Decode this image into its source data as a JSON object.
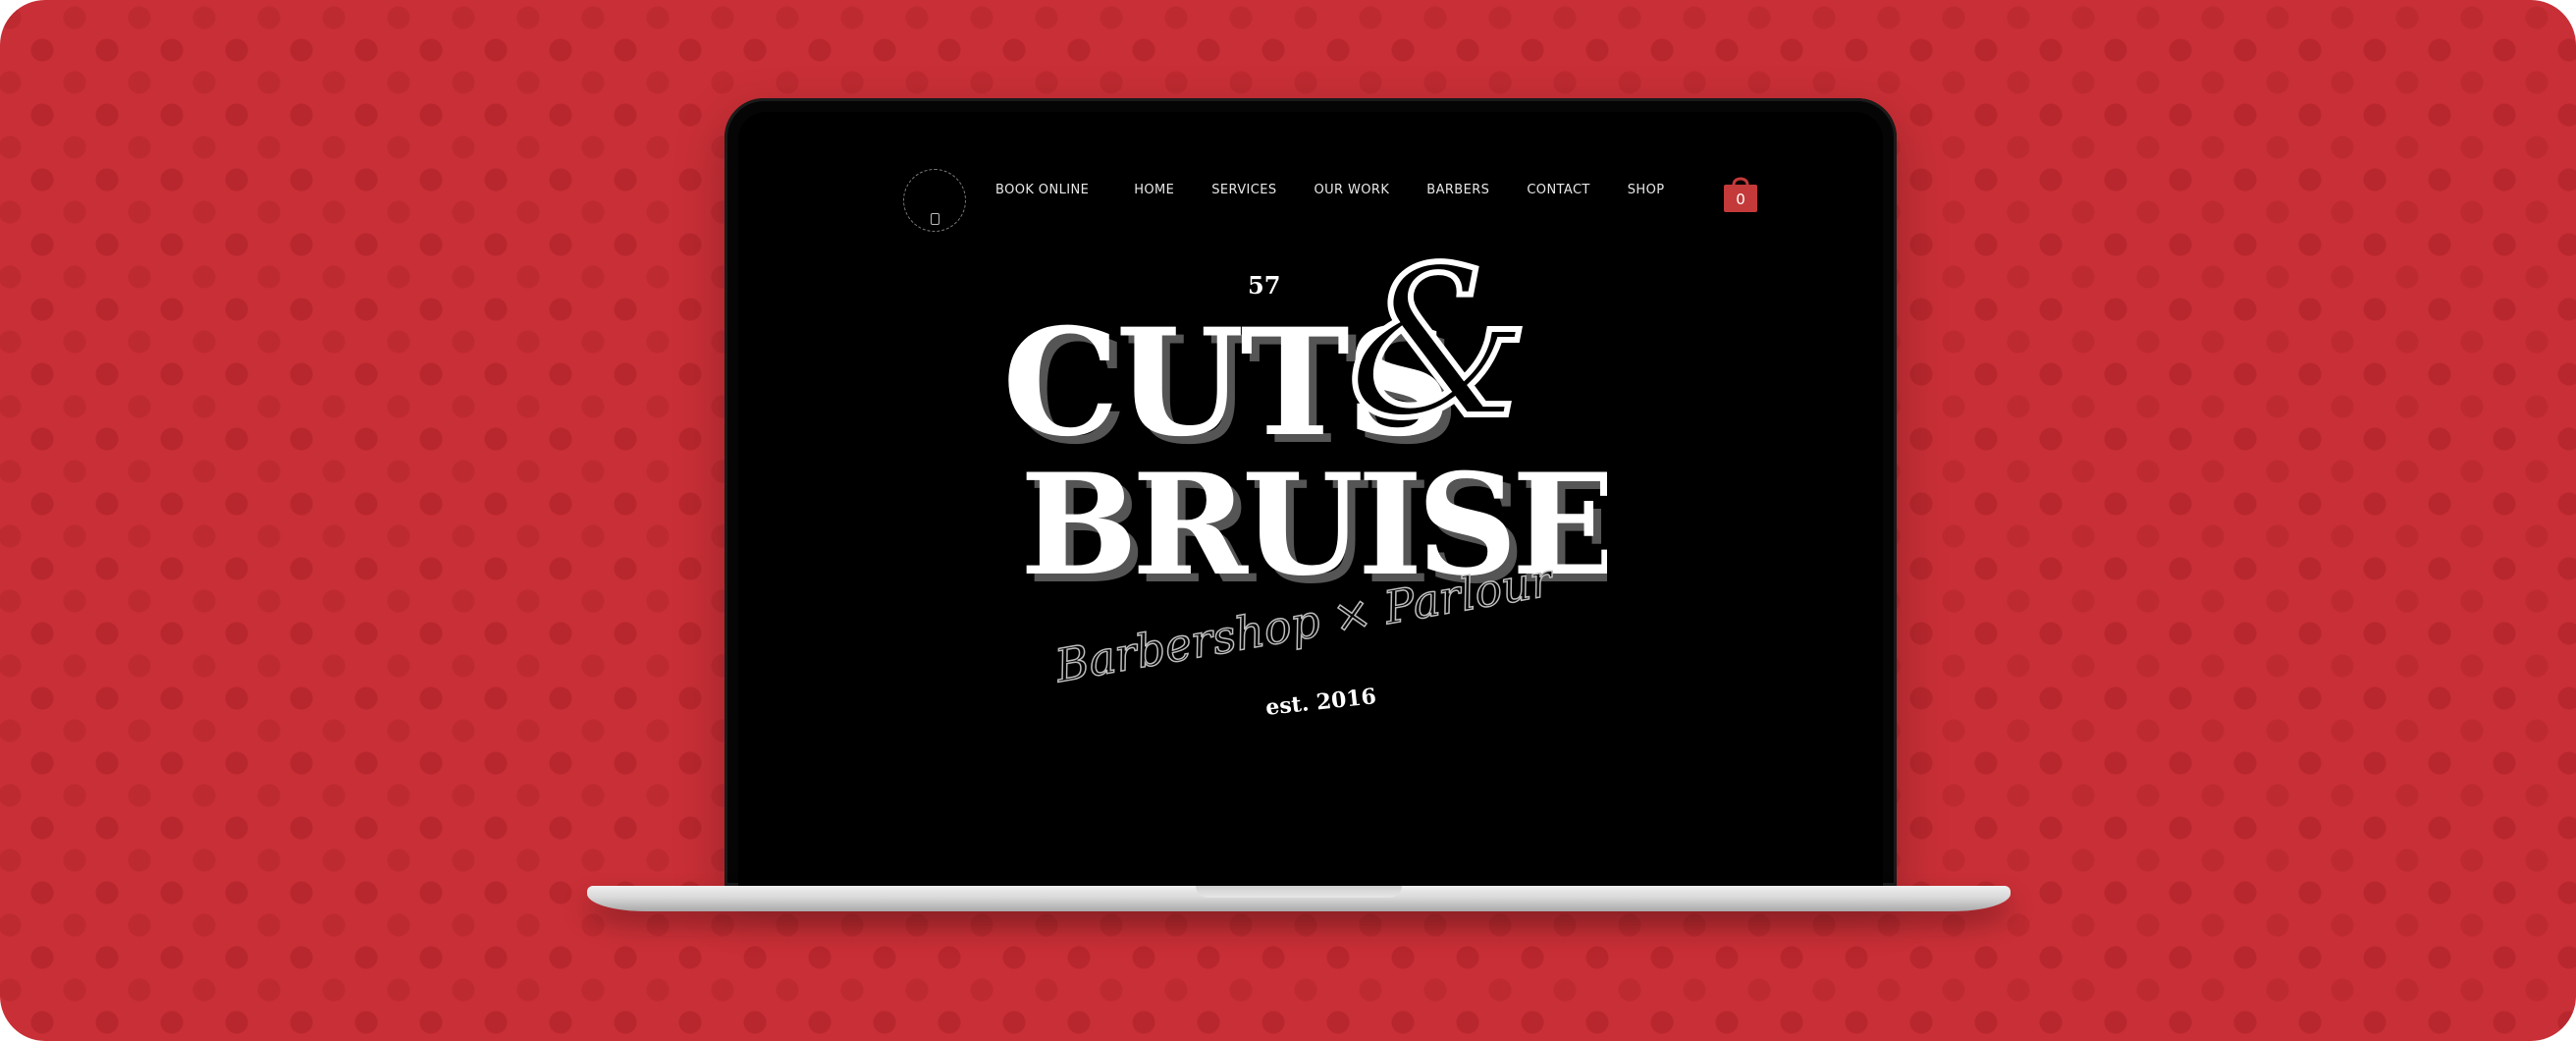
{
  "nav": {
    "logo_alt": "Cuts & Bruises Barbershop round logo",
    "items": [
      {
        "label": "BOOK ONLINE"
      },
      {
        "label": "HOME"
      },
      {
        "label": "SERVICES"
      },
      {
        "label": "OUR WORK"
      },
      {
        "label": "BARBERS"
      },
      {
        "label": "CONTACT"
      },
      {
        "label": "SHOP"
      }
    ],
    "cart": {
      "icon": "shopping-bag-icon",
      "count": "0"
    }
  },
  "hero": {
    "number": "57",
    "wordmark_line1": "CUTS",
    "ampersand": "&",
    "wordmark_line2": "BRUISES",
    "tagline": "Barbershop × Parlour",
    "established": "est. 2016"
  },
  "colors": {
    "background_red": "#c92f36",
    "dot_red": "#b8272d",
    "screen_black": "#000000",
    "cart_red": "#c43a3a",
    "text_white": "#ffffff"
  }
}
